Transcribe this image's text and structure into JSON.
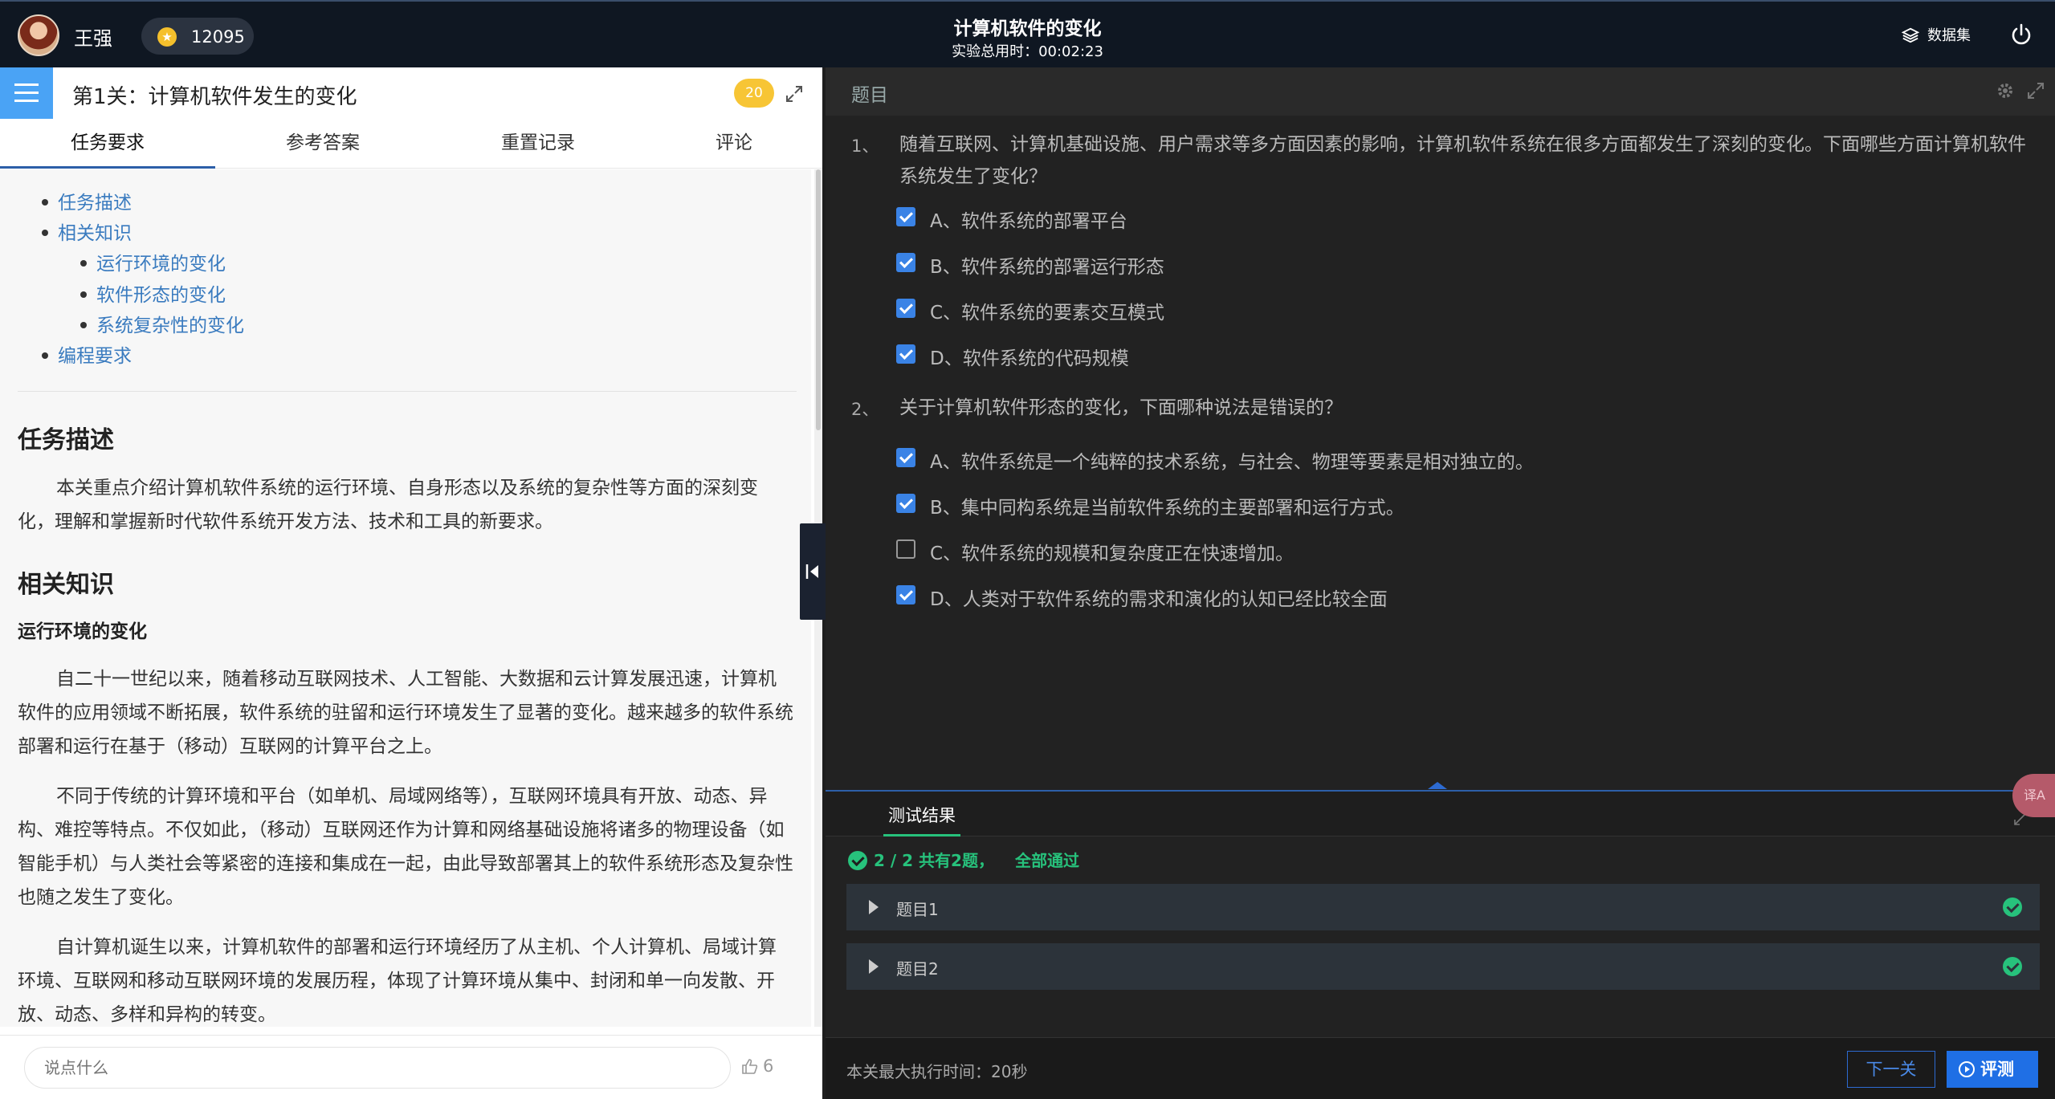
{
  "header": {
    "username": "王强",
    "coins": "12095",
    "title": "计算机软件的变化",
    "time_label": "实验总用时：",
    "time_value": "00:02:23",
    "dataset_label": "数据集"
  },
  "left": {
    "level_title": "第1关：计算机软件发生的变化",
    "badge": "20",
    "tabs": [
      "任务要求",
      "参考答案",
      "重置记录",
      "评论"
    ],
    "toc": [
      "任务描述",
      "相关知识",
      "运行环境的变化",
      "软件形态的变化",
      "系统复杂性的变化",
      "编程要求"
    ],
    "sec1_title": "任务描述",
    "sec1_para": "本关重点介绍计算机软件系统的运行环境、自身形态以及系统的复杂性等方面的深刻变化，理解和掌握新时代软件系统开发方法、技术和工具的新要求。",
    "sec2_title": "相关知识",
    "sub1_title": "运行环境的变化",
    "para1": "自二十一世纪以来，随着移动互联网技术、人工智能、大数据和云计算发展迅速，计算机软件的应用领域不断拓展，软件系统的驻留和运行环境发生了显著的变化。越来越多的软件系统部署和运行在基于（移动）互联网的计算平台之上。",
    "para2": "不同于传统的计算环境和平台（如单机、局域网络等），互联网环境具有开放、动态、异构、难控等特点。不仅如此，（移动）互联网还作为计算和网络基础设施将诸多的物理设备（如智能手机）与人类社会等紧密的连接和集成在一起，由此导致部署其上的软件系统形态及复杂性也随之发生了变化。",
    "para3": "自计算机诞生以来，计算机软件的部署和运行环境经历了从主机、个人计算机、局域计算环境、互联网和移动互联网环境的发展历程，体现了计算环境从集中、封闭和单一向发散、开放、动态、多样和异构的转变。",
    "comment_placeholder": "说点什么",
    "likes": "6"
  },
  "right": {
    "panel_label": "题目",
    "questions": [
      {
        "num": "1、",
        "text": "随着互联网、计算机基础设施、用户需求等多方面因素的影响，计算机软件系统在很多方面都发生了深刻的变化。下面哪些方面计算机软件系统发生了变化？",
        "options": [
          {
            "text": "A、软件系统的部署平台",
            "checked": true
          },
          {
            "text": "B、软件系统的部署运行形态",
            "checked": true
          },
          {
            "text": "C、软件系统的要素交互模式",
            "checked": true
          },
          {
            "text": "D、软件系统的代码规模",
            "checked": true
          }
        ]
      },
      {
        "num": "2、",
        "text": "关于计算机软件形态的变化，下面哪种说法是错误的？",
        "options": [
          {
            "text": "A、软件系统是一个纯粹的技术系统，与社会、物理等要素是相对独立的。",
            "checked": true
          },
          {
            "text": "B、集中同构系统是当前软件系统的主要部署和运行方式。",
            "checked": true
          },
          {
            "text": "C、软件系统的规模和复杂度正在快速增加。",
            "checked": false
          },
          {
            "text": "D、人类对于软件系统的需求和演化的认知已经比较全面",
            "checked": true
          }
        ]
      }
    ],
    "result_tab": "测试结果",
    "translate_label": "译A",
    "summary_count": "2 / 2 共有2题，",
    "summary_pass": "全部通过",
    "cases": [
      "题目1",
      "题目2"
    ],
    "max_time": "本关最大执行时间：20秒",
    "next_label": "下一关",
    "eval_label": "评测"
  }
}
